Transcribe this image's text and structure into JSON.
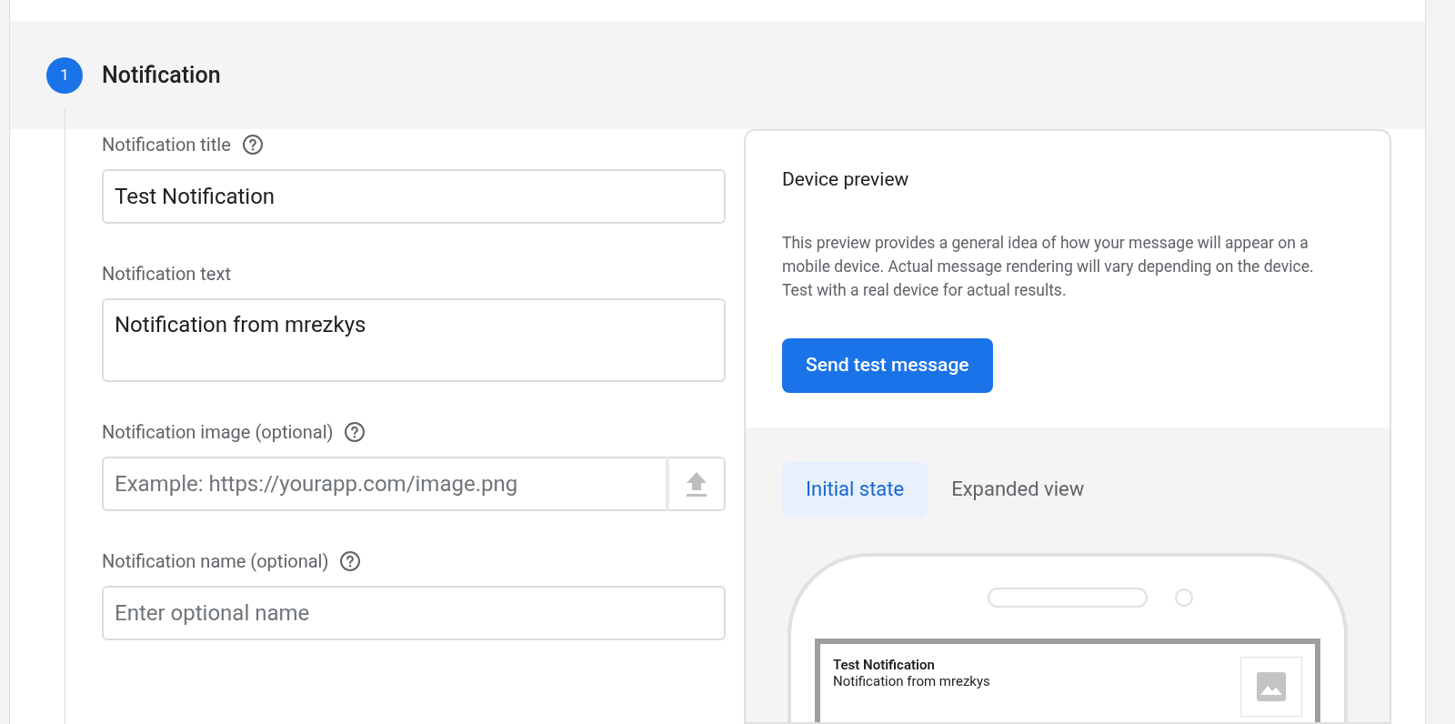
{
  "step": {
    "number": "1",
    "title": "Notification"
  },
  "fields": [
    {
      "kind": "text",
      "label": "Notification title",
      "help": true,
      "value": "Test Notification"
    },
    {
      "kind": "textarea",
      "label": "Notification text",
      "help": false,
      "value": "Notification from mrezkys"
    },
    {
      "kind": "upload",
      "label": "Notification image (optional)",
      "help": true,
      "placeholder": "Example: https://yourapp.com/image.png"
    },
    {
      "kind": "text",
      "label": "Notification name (optional)",
      "help": true,
      "placeholder": "Enter optional name"
    }
  ],
  "preview": {
    "title": "Device preview",
    "description": "This preview provides a general idea of how your message will appear on a mobile device. Actual message rendering will vary depending on the device. Test with a real device for actual results.",
    "button": "Send test message",
    "tabs": [
      {
        "label": "Initial state",
        "selected": true
      },
      {
        "label": "Expanded view",
        "selected": false
      }
    ],
    "notification": {
      "title": "Test Notification",
      "body": "Notification from mrezkys"
    }
  }
}
